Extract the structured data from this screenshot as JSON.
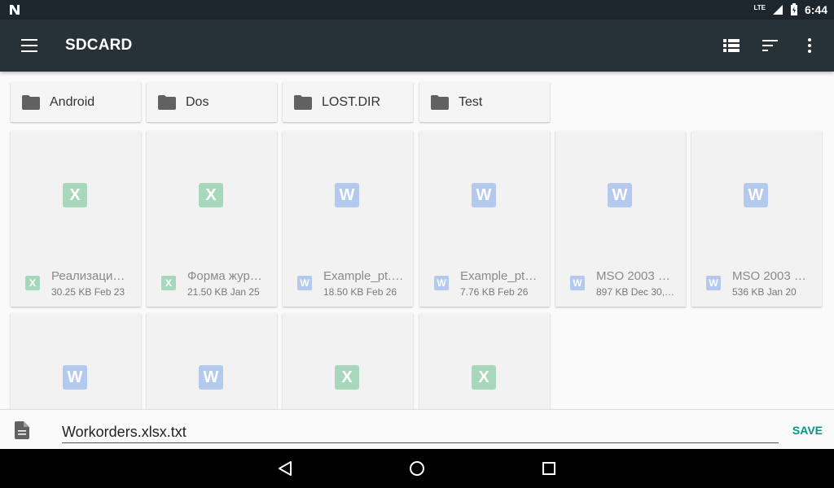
{
  "status_bar": {
    "network": "LTE",
    "time": "6:44"
  },
  "app_bar": {
    "title": "SDCARD",
    "icons": [
      "menu-icon",
      "list-view-icon",
      "sort-icon",
      "more-vert-icon"
    ]
  },
  "folders": [
    {
      "name": "Android"
    },
    {
      "name": "Dos"
    },
    {
      "name": "LOST.DIR"
    },
    {
      "name": "Test"
    }
  ],
  "files": [
    {
      "type": "X",
      "name": "Реализаци…",
      "meta": "30.25 KB Feb 23"
    },
    {
      "type": "X",
      "name": "Форма жур…",
      "meta": "21.50 KB Jan 25"
    },
    {
      "type": "W",
      "name": "Example_pt.…",
      "meta": "18.50 KB Feb 26"
    },
    {
      "type": "W",
      "name": "Example_pt…",
      "meta": "7.76 KB Feb 26"
    },
    {
      "type": "W",
      "name": "MSO 2003 …",
      "meta": "897 KB Dec 30,…"
    },
    {
      "type": "W",
      "name": "MSO 2003 …",
      "meta": "536 KB Jan 20"
    },
    {
      "type": "W",
      "name": "",
      "meta": ""
    },
    {
      "type": "W",
      "name": "",
      "meta": ""
    },
    {
      "type": "X",
      "name": "",
      "meta": ""
    },
    {
      "type": "X",
      "name": "",
      "meta": ""
    }
  ],
  "colors": {
    "excel": "#a8d8bc",
    "word": "#b4c9ee",
    "accent": "#009688",
    "app_bar": "#263238"
  },
  "save_bar": {
    "filename": "Workorders.xlsx.txt",
    "save_label": "SAVE"
  }
}
